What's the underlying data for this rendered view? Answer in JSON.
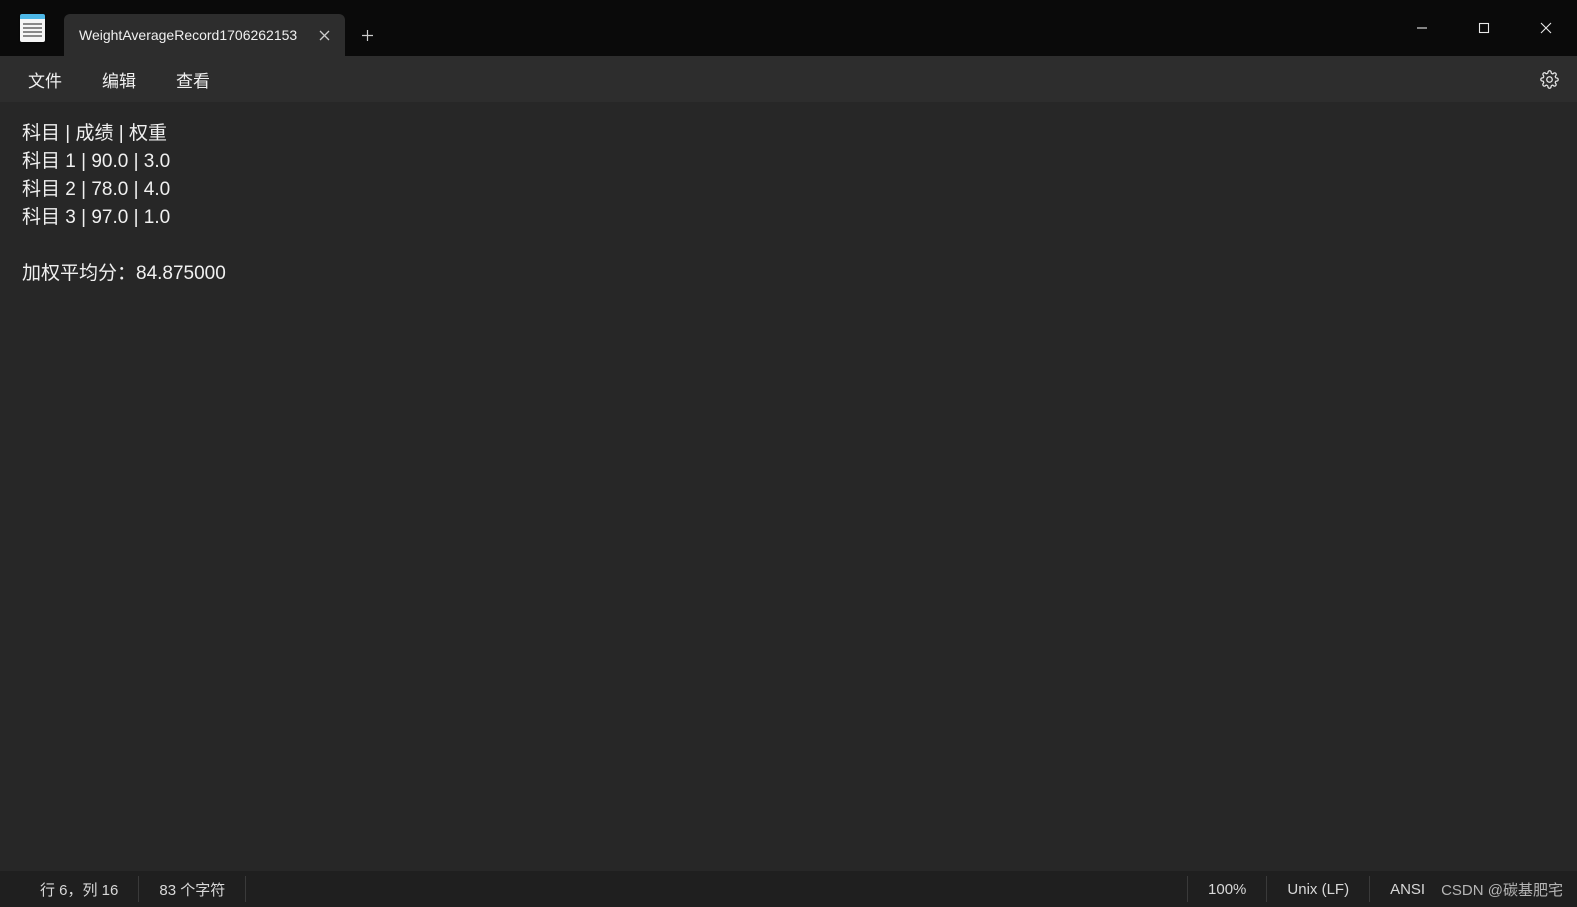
{
  "tab": {
    "title": "WeightAverageRecord1706262153"
  },
  "menu": {
    "file": "文件",
    "edit": "编辑",
    "view": "查看"
  },
  "editor": {
    "content": "科目 | 成绩 | 权重\n科目 1 | 90.0 | 3.0\n科目 2 | 78.0 | 4.0\n科目 3 | 97.0 | 1.0\n\n加权平均分：84.875000"
  },
  "status": {
    "cursor": "行 6，列 16",
    "chars": "83 个字符",
    "zoom": "100%",
    "line_ending": "Unix (LF)",
    "encoding": "ANSI"
  },
  "watermark": "CSDN @碳基肥宅"
}
